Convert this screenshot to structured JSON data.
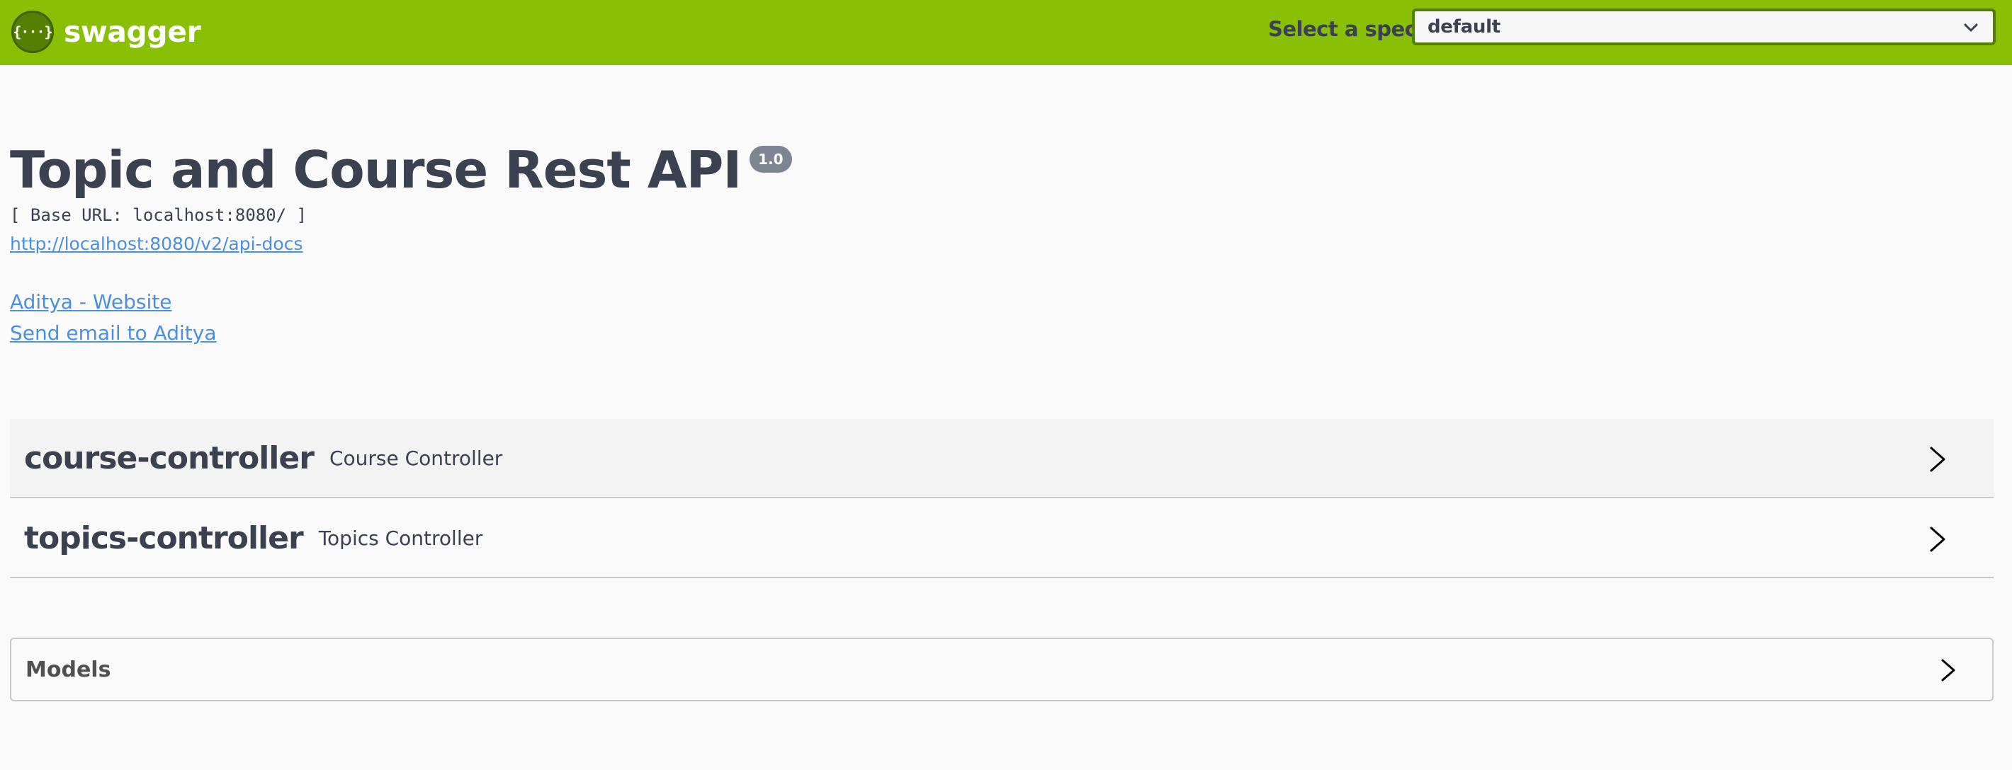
{
  "topbar": {
    "logo_mark": "{···}",
    "logo_text": "swagger",
    "spec_label": "Select a spec",
    "spec_selected": "default",
    "spec_icon": "chevron-down-icon",
    "bar_color": "#89bf04"
  },
  "info": {
    "title": "Topic and Course Rest API",
    "version": "1.0",
    "base_url": "[ Base URL: localhost:8080/ ]",
    "api_docs_link": "http://localhost:8080/v2/api-docs",
    "contact_website": "Aditya - Website",
    "contact_email": "Send email to Aditya",
    "link_color": "#4990e2"
  },
  "tags": [
    {
      "name": "course-controller",
      "description": "Course Controller",
      "icon": "chevron-right-icon"
    },
    {
      "name": "topics-controller",
      "description": "Topics Controller",
      "icon": "chevron-right-icon"
    }
  ],
  "models": {
    "title": "Models",
    "icon": "chevron-right-icon"
  }
}
